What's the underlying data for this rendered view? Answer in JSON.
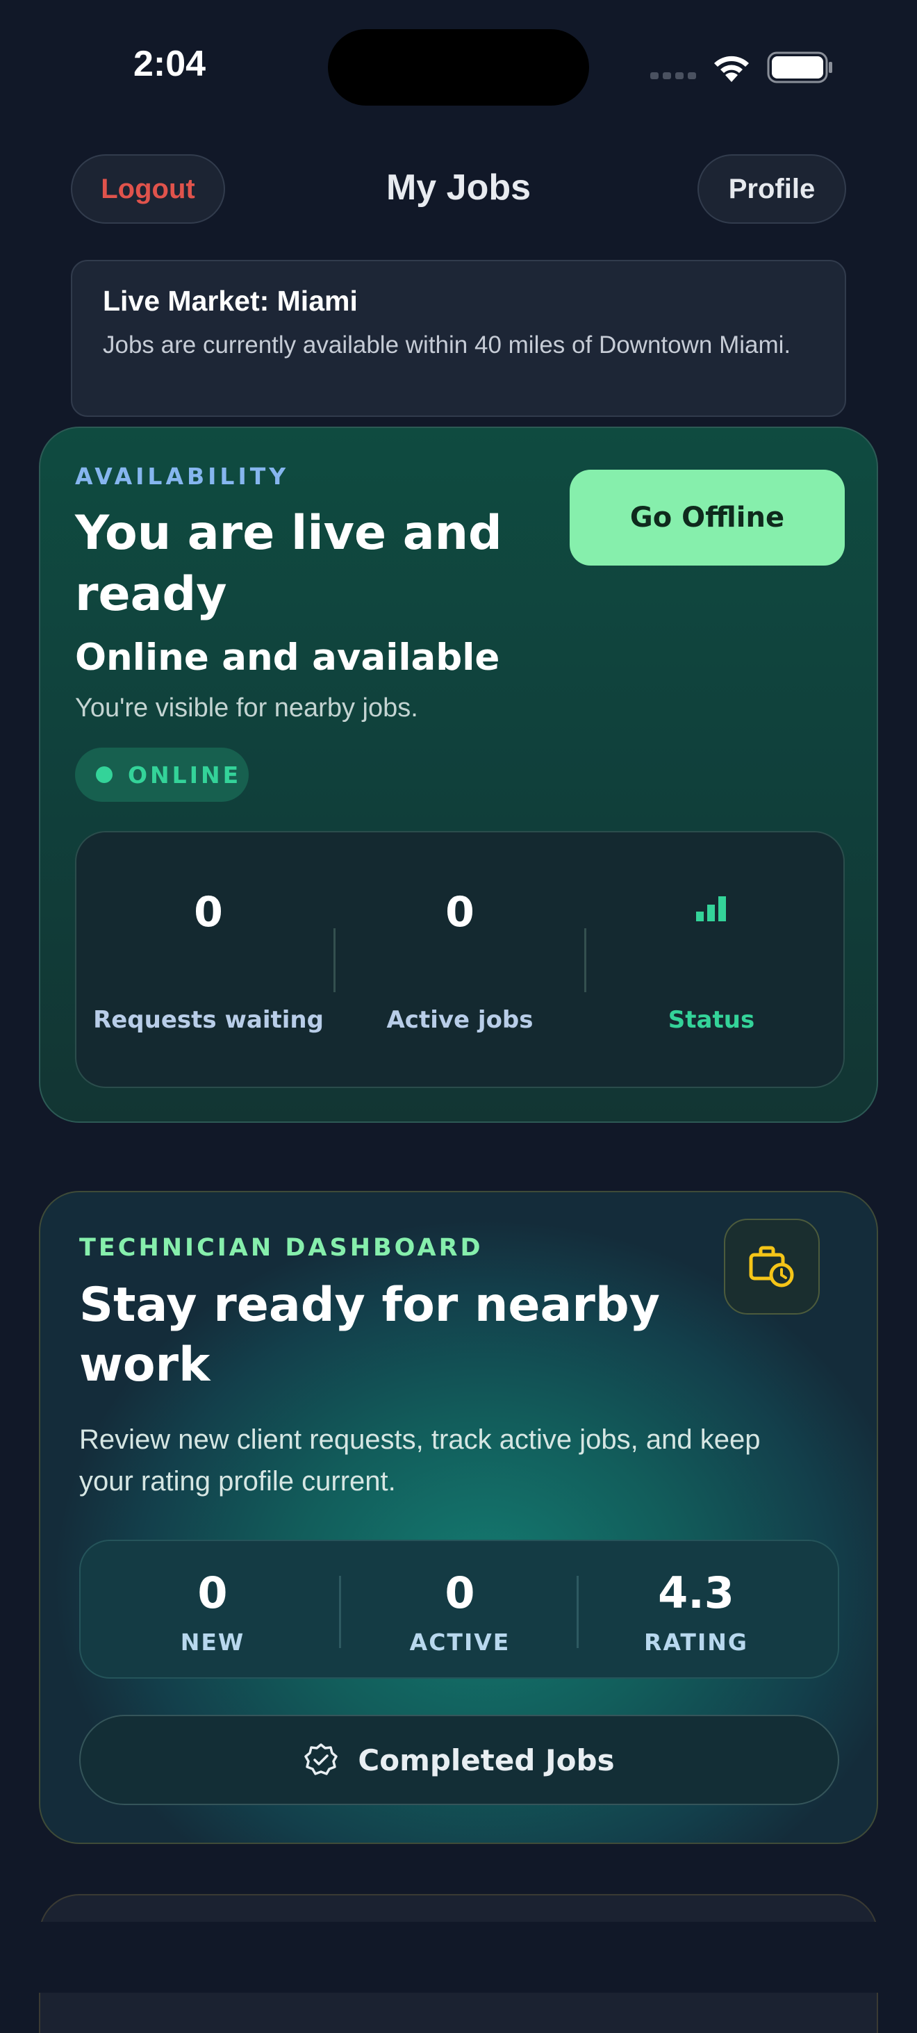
{
  "status_bar": {
    "time": "2:04"
  },
  "header": {
    "logout_label": "Logout",
    "title": "My Jobs",
    "profile_label": "Profile"
  },
  "market": {
    "title": "Live Market: Miami",
    "description": "Jobs are currently available within 40 miles of Downtown Miami."
  },
  "availability": {
    "eyebrow": "AVAILABILITY",
    "heading": "You are live and ready",
    "subheading": "Online and available",
    "description": "You're visible for nearby jobs.",
    "badge": "ONLINE",
    "toggle_label": "Go Offline",
    "stats": [
      {
        "value": "0",
        "label": "Requests waiting"
      },
      {
        "value": "0",
        "label": "Active jobs"
      },
      {
        "icon": "signal-bars-icon",
        "label": "Status"
      }
    ]
  },
  "technician": {
    "eyebrow": "TECHNICIAN DASHBOARD",
    "heading": "Stay ready for nearby work",
    "description": "Review new client requests, track active jobs, and keep your rating profile current.",
    "icon": "briefcase-clock-icon",
    "stats": [
      {
        "value": "0",
        "label": "NEW"
      },
      {
        "value": "0",
        "label": "ACTIVE"
      },
      {
        "value": "4.3",
        "label": "RATING"
      }
    ],
    "completed_label": "Completed Jobs"
  },
  "colors": {
    "background": "#111828",
    "accent_green": "#86efac",
    "online_green": "#34d399",
    "logout_red": "#e0534c",
    "icon_yellow": "#f5c518"
  }
}
